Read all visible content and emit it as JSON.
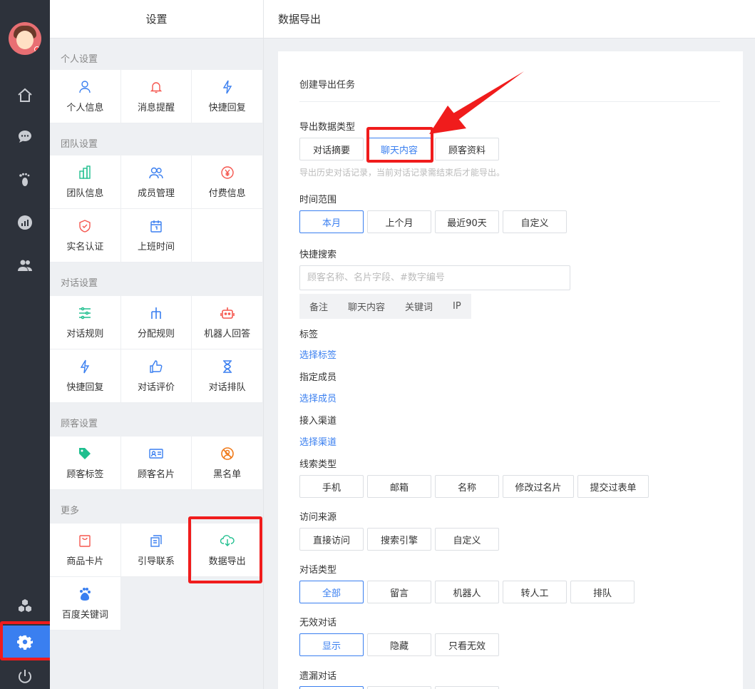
{
  "settings_panel": {
    "title": "设置",
    "groups": [
      {
        "title": "个人设置",
        "items": [
          {
            "label": "个人信息",
            "icon": "user-icon"
          },
          {
            "label": "消息提醒",
            "icon": "bell-icon"
          },
          {
            "label": "快捷回复",
            "icon": "lightning-icon"
          }
        ]
      },
      {
        "title": "团队设置",
        "items": [
          {
            "label": "团队信息",
            "icon": "building-icon"
          },
          {
            "label": "成员管理",
            "icon": "users-icon"
          },
          {
            "label": "付费信息",
            "icon": "yen-icon"
          },
          {
            "label": "实名认证",
            "icon": "shield-icon"
          },
          {
            "label": "上班时间",
            "icon": "calendar-icon"
          }
        ]
      },
      {
        "title": "对话设置",
        "items": [
          {
            "label": "对话规则",
            "icon": "sliders-icon"
          },
          {
            "label": "分配规则",
            "icon": "split-icon"
          },
          {
            "label": "机器人回答",
            "icon": "robot-icon"
          },
          {
            "label": "快捷回复",
            "icon": "lightning-icon"
          },
          {
            "label": "对话评价",
            "icon": "thumbs-up-icon"
          },
          {
            "label": "对话排队",
            "icon": "hourglass-icon"
          }
        ]
      },
      {
        "title": "顾客设置",
        "items": [
          {
            "label": "顾客标签",
            "icon": "tag-icon"
          },
          {
            "label": "顾客名片",
            "icon": "id-card-icon"
          },
          {
            "label": "黑名单",
            "icon": "block-user-icon"
          }
        ]
      },
      {
        "title": "更多",
        "items": [
          {
            "label": "商品卡片",
            "icon": "shopping-bag-icon"
          },
          {
            "label": "引导联系",
            "icon": "copy-icon"
          },
          {
            "label": "数据导出",
            "icon": "cloud-download-icon"
          },
          {
            "label": "百度关键词",
            "icon": "baidu-paw-icon"
          }
        ]
      }
    ]
  },
  "main": {
    "header_title": "数据导出",
    "card_title": "创建导出任务",
    "export_type": {
      "label": "导出数据类型",
      "options": [
        "对话摘要",
        "聊天内容",
        "顾客资料"
      ],
      "selected": "聊天内容",
      "hint": "导出历史对话记录，当前对话记录需结束后才能导出。"
    },
    "time_range": {
      "label": "时间范围",
      "options": [
        "本月",
        "上个月",
        "最近90天",
        "自定义"
      ],
      "selected": "本月"
    },
    "quick_search": {
      "label": "快捷搜索",
      "placeholder": "顾客名称、名片字段、#数字编号",
      "chips": [
        "备注",
        "聊天内容",
        "关键词",
        "IP"
      ]
    },
    "tags": {
      "label": "标签",
      "link": "选择标签"
    },
    "members": {
      "label": "指定成员",
      "link": "选择成员"
    },
    "channel": {
      "label": "接入渠道",
      "link": "选择渠道"
    },
    "lead_type": {
      "label": "线索类型",
      "options": [
        "手机",
        "邮箱",
        "名称",
        "修改过名片",
        "提交过表单"
      ]
    },
    "visit_source": {
      "label": "访问来源",
      "options": [
        "直接访问",
        "搜索引擎",
        "自定义"
      ]
    },
    "dialog_type": {
      "label": "对话类型",
      "options": [
        "全部",
        "留言",
        "机器人",
        "转人工",
        "排队"
      ],
      "selected": "全部"
    },
    "invalid_dialog": {
      "label": "无效对话",
      "options": [
        "显示",
        "隐藏",
        "只看无效"
      ],
      "selected": "显示"
    },
    "missed_dialog": {
      "label": "遗漏对话"
    }
  },
  "colors": {
    "accent": "#3a7ff0",
    "rail": "#2d323b",
    "highlight": "#f01c1c"
  }
}
